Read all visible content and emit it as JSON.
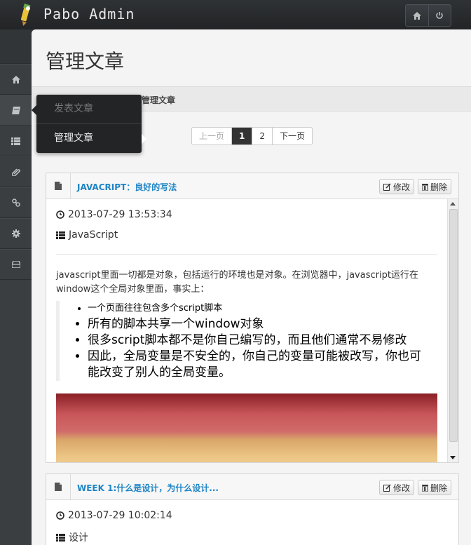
{
  "app": {
    "brand": "Pabo Admin"
  },
  "topbar": {
    "icons": [
      "home-icon",
      "power-icon"
    ]
  },
  "sidebar": {
    "items": [
      {
        "icon": "home-icon"
      },
      {
        "icon": "book-icon"
      },
      {
        "icon": "list-icon"
      },
      {
        "icon": "paperclip-icon"
      },
      {
        "icon": "link-icon"
      },
      {
        "icon": "gear-icon"
      },
      {
        "icon": "inbox-icon"
      }
    ]
  },
  "page": {
    "title": "管理文章",
    "breadcrumb": "管理文章"
  },
  "flyout": {
    "items": [
      {
        "label": "发表文章"
      },
      {
        "label": "管理文章"
      }
    ]
  },
  "pager": {
    "prev": "上一页",
    "pages": [
      "1",
      "2"
    ],
    "next": "下一页"
  },
  "actions": {
    "edit": "修改",
    "delete": "删除"
  },
  "posts": [
    {
      "title": "JAVACRIPT：良好的写法",
      "datetime": "2013-07-29 13:53:34",
      "category": "JavaScript",
      "paragraph": "javascript里面一切都是对象，包括运行的环境也是对象。在浏览器中，javascript运行在window这个全局对象里面，事实上：",
      "bullets": [
        "一个页面往往包含多个script脚本",
        "所有的脚本共享一个window对象",
        "很多script脚本都不是你自己编写的，而且他们通常不易修改",
        "因此，全局变量是不安全的，你自己的变量可能被改写，你也可能改变了别人的全局变量。"
      ]
    },
    {
      "title": "WEEK 1:什么是设计，为什么设计...",
      "datetime": "2013-07-29 10:02:14",
      "category": "设计"
    }
  ]
}
